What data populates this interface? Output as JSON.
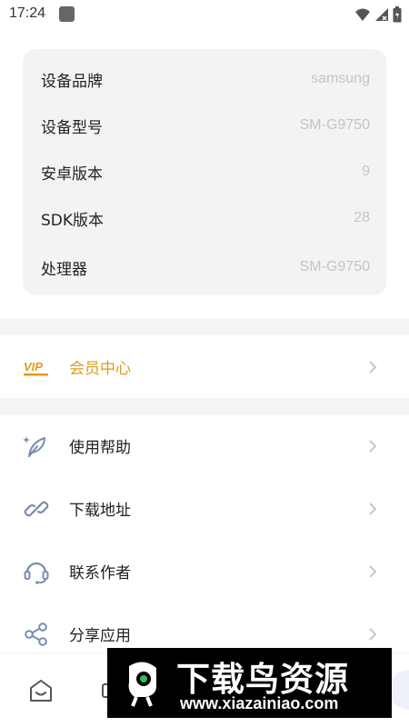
{
  "status_bar": {
    "time": "17:24",
    "icons": [
      "app-notification-icon",
      "wifi-icon",
      "signal-icon",
      "battery-icon"
    ]
  },
  "device_info": [
    {
      "label": "设备品牌",
      "value": "samsung"
    },
    {
      "label": "设备型号",
      "value": "SM-G9750"
    },
    {
      "label": "安卓版本",
      "value": "9"
    },
    {
      "label": "SDK版本",
      "value": "28"
    },
    {
      "label": "处理器",
      "value": "SM-G9750"
    }
  ],
  "vip": {
    "badge": "VIP",
    "label": "会员中心",
    "color": "#e29a1c"
  },
  "menu": [
    {
      "label": "使用帮助",
      "icon": "feather-icon"
    },
    {
      "label": "下载地址",
      "icon": "link-icon"
    },
    {
      "label": "联系作者",
      "icon": "headset-icon"
    },
    {
      "label": "分享应用",
      "icon": "share-icon"
    }
  ],
  "bottom_nav": {
    "icons": [
      "home-icon",
      "apps-icon"
    ]
  },
  "watermark": {
    "title": "下载鸟资源",
    "url": "www.xiazainiao.com"
  },
  "colors": {
    "accent": "#e29a1c",
    "icon_stroke": "#7a8bb0",
    "card_bg": "#f3f3f3",
    "value_gray": "#c4c4c4"
  }
}
